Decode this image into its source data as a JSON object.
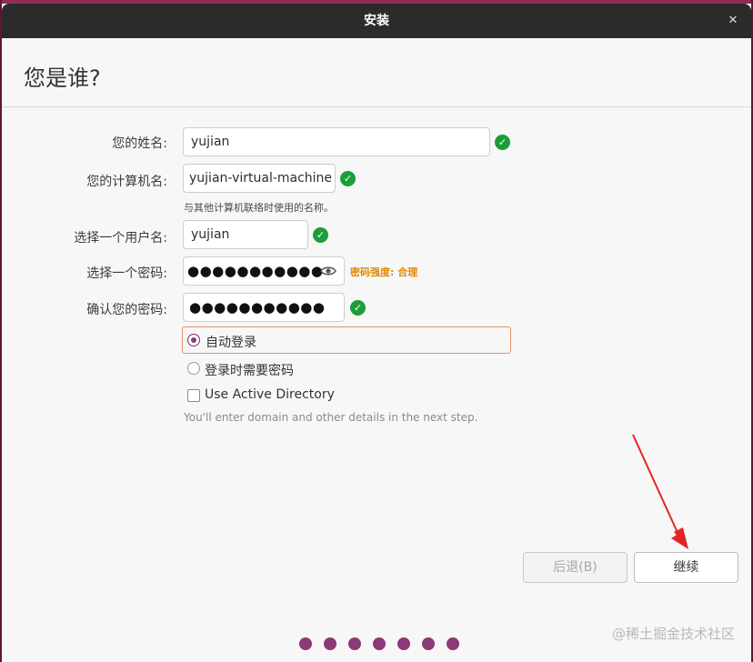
{
  "window": {
    "title": "安装"
  },
  "page": {
    "title": "您是谁?"
  },
  "form": {
    "name": {
      "label": "您的姓名:",
      "value": "yujian"
    },
    "computer": {
      "label": "您的计算机名:",
      "value": "yujian-virtual-machine",
      "hint": "与其他计算机联络时使用的名称。"
    },
    "username": {
      "label": "选择一个用户名:",
      "value": "yujian"
    },
    "password": {
      "label": "选择一个密码:",
      "masked": "●●●●●●●●●●●",
      "strength": "密码强度: 合理"
    },
    "confirm": {
      "label": "确认您的密码:",
      "masked": "●●●●●●●●●●●"
    }
  },
  "login": {
    "auto_login": "自动登录",
    "require_password": "登录时需要密码",
    "selected": "auto_login",
    "active_directory": "Use Active Directory",
    "active_directory_checked": false,
    "ad_note": "You'll enter domain and other details in the next step."
  },
  "buttons": {
    "back": "后退(B)",
    "next": "继续"
  },
  "pager": {
    "count": 7
  },
  "watermark": "@稀土掘金技术社区",
  "icons": {
    "check": "✓",
    "close": "✕"
  },
  "colors": {
    "accent": "#8b3a75",
    "success": "#1b9e3a",
    "warning": "#e08a00",
    "focus_border": "#e8926a"
  }
}
